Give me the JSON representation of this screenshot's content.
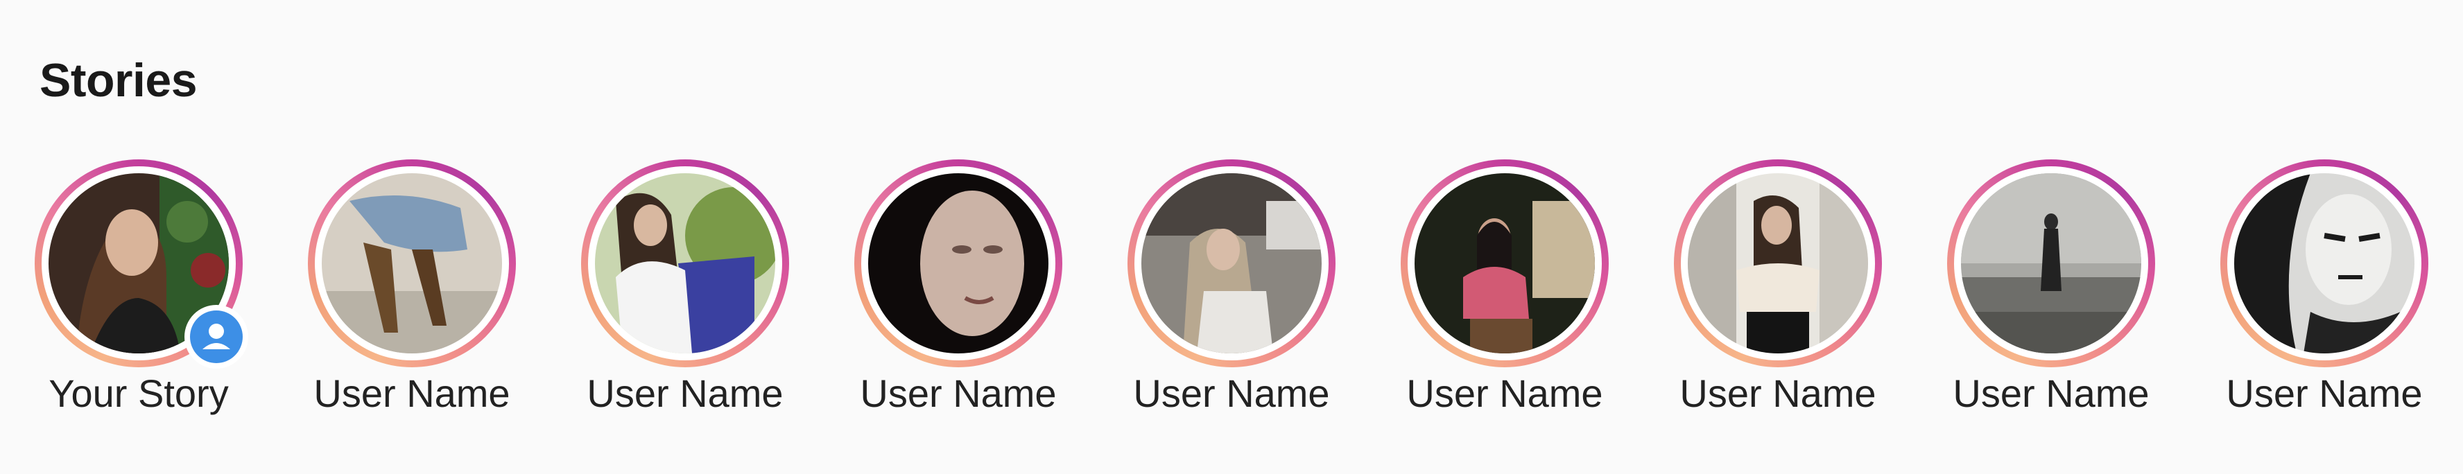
{
  "header": {
    "title": "Stories"
  },
  "stories": [
    {
      "label": "Your Story",
      "avatar_icon": "avatar-photo",
      "has_add_badge": true
    },
    {
      "label": "User Name",
      "avatar_icon": "avatar-photo"
    },
    {
      "label": "User Name",
      "avatar_icon": "avatar-photo"
    },
    {
      "label": "User Name",
      "avatar_icon": "avatar-photo"
    },
    {
      "label": "User Name",
      "avatar_icon": "avatar-photo"
    },
    {
      "label": "User Name",
      "avatar_icon": "avatar-photo"
    },
    {
      "label": "User Name",
      "avatar_icon": "avatar-photo"
    },
    {
      "label": "User Name",
      "avatar_icon": "avatar-photo"
    },
    {
      "label": "User Name",
      "avatar_icon": "avatar-photo"
    }
  ],
  "colors": {
    "ring_gradient": [
      "#f7b58a",
      "#e97aa0",
      "#c53f9c",
      "#b03aa0"
    ],
    "add_badge": "#3d8fe6",
    "text": "#222222",
    "background": "#fafafa"
  }
}
